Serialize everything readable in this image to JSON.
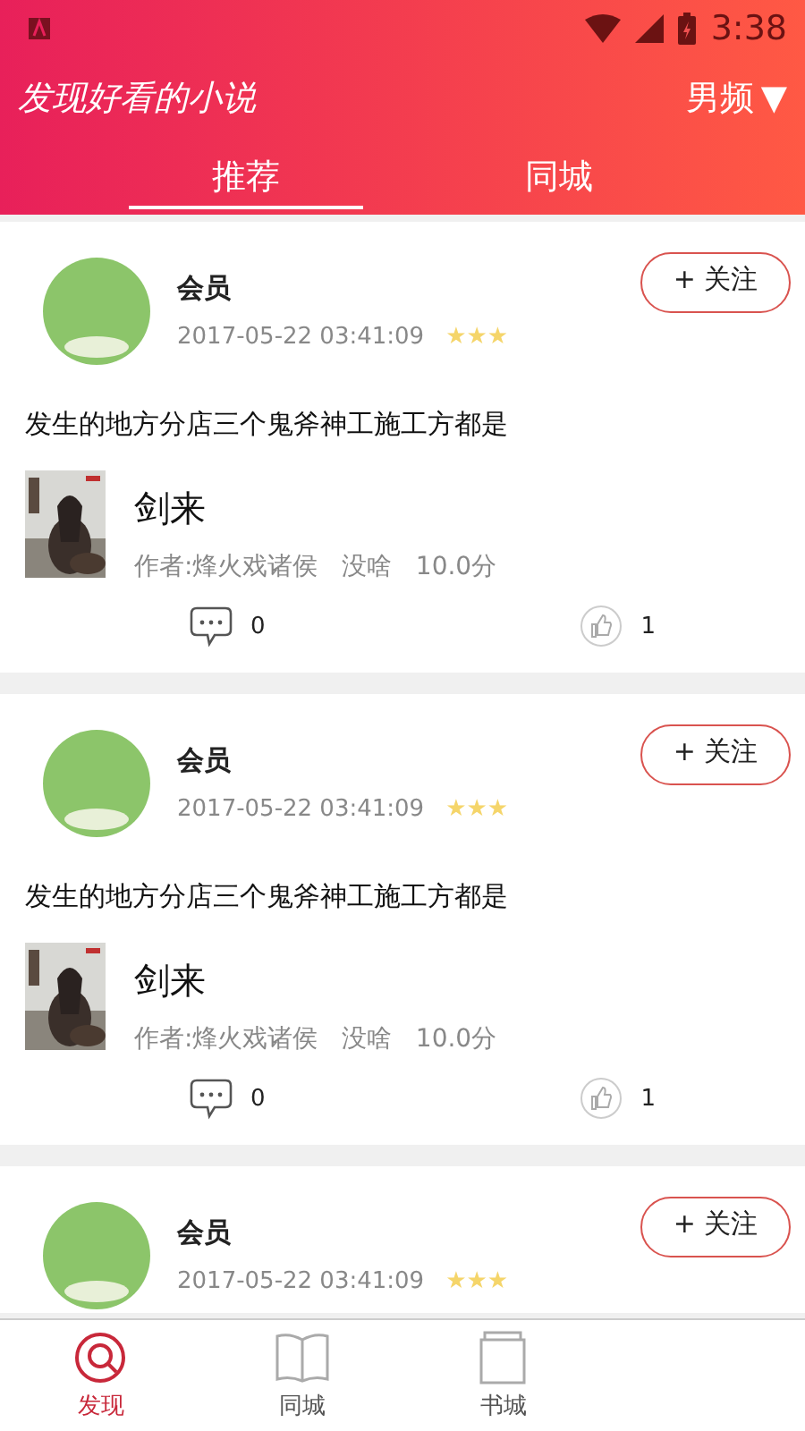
{
  "status_bar": {
    "time": "3:38"
  },
  "header": {
    "title": "发现好看的小说",
    "channel": "男频",
    "channel_caret": "▼"
  },
  "tabs": [
    {
      "label": "推荐",
      "selected": true
    },
    {
      "label": "同城",
      "selected": false
    }
  ],
  "posts": [
    {
      "user": "会员",
      "time": "2017-05-22 03:41:09",
      "stars": 3,
      "follow": "+ 关注",
      "text": "发生的地方分店三个鬼斧神工施工方都是",
      "book": {
        "title": "剑来",
        "meta": "作者:烽火戏诸侯   没啥   10.0分"
      },
      "comments": "0",
      "likes": "1"
    },
    {
      "user": "会员",
      "time": "2017-05-22 03:41:09",
      "stars": 3,
      "follow": "+ 关注",
      "text": "发生的地方分店三个鬼斧神工施工方都是",
      "book": {
        "title": "剑来",
        "meta": "作者:烽火戏诸侯   没啥   10.0分"
      },
      "comments": "0",
      "likes": "1"
    },
    {
      "user": "会员",
      "time": "2017-05-22 03:41:09",
      "stars": 3,
      "follow": "+ 关注"
    }
  ],
  "bottom_nav": [
    {
      "label": "发现",
      "kind": "discover",
      "selected": true
    },
    {
      "label": "同城",
      "kind": "book",
      "selected": false
    },
    {
      "label": "书城",
      "kind": "shelf",
      "selected": false
    }
  ]
}
